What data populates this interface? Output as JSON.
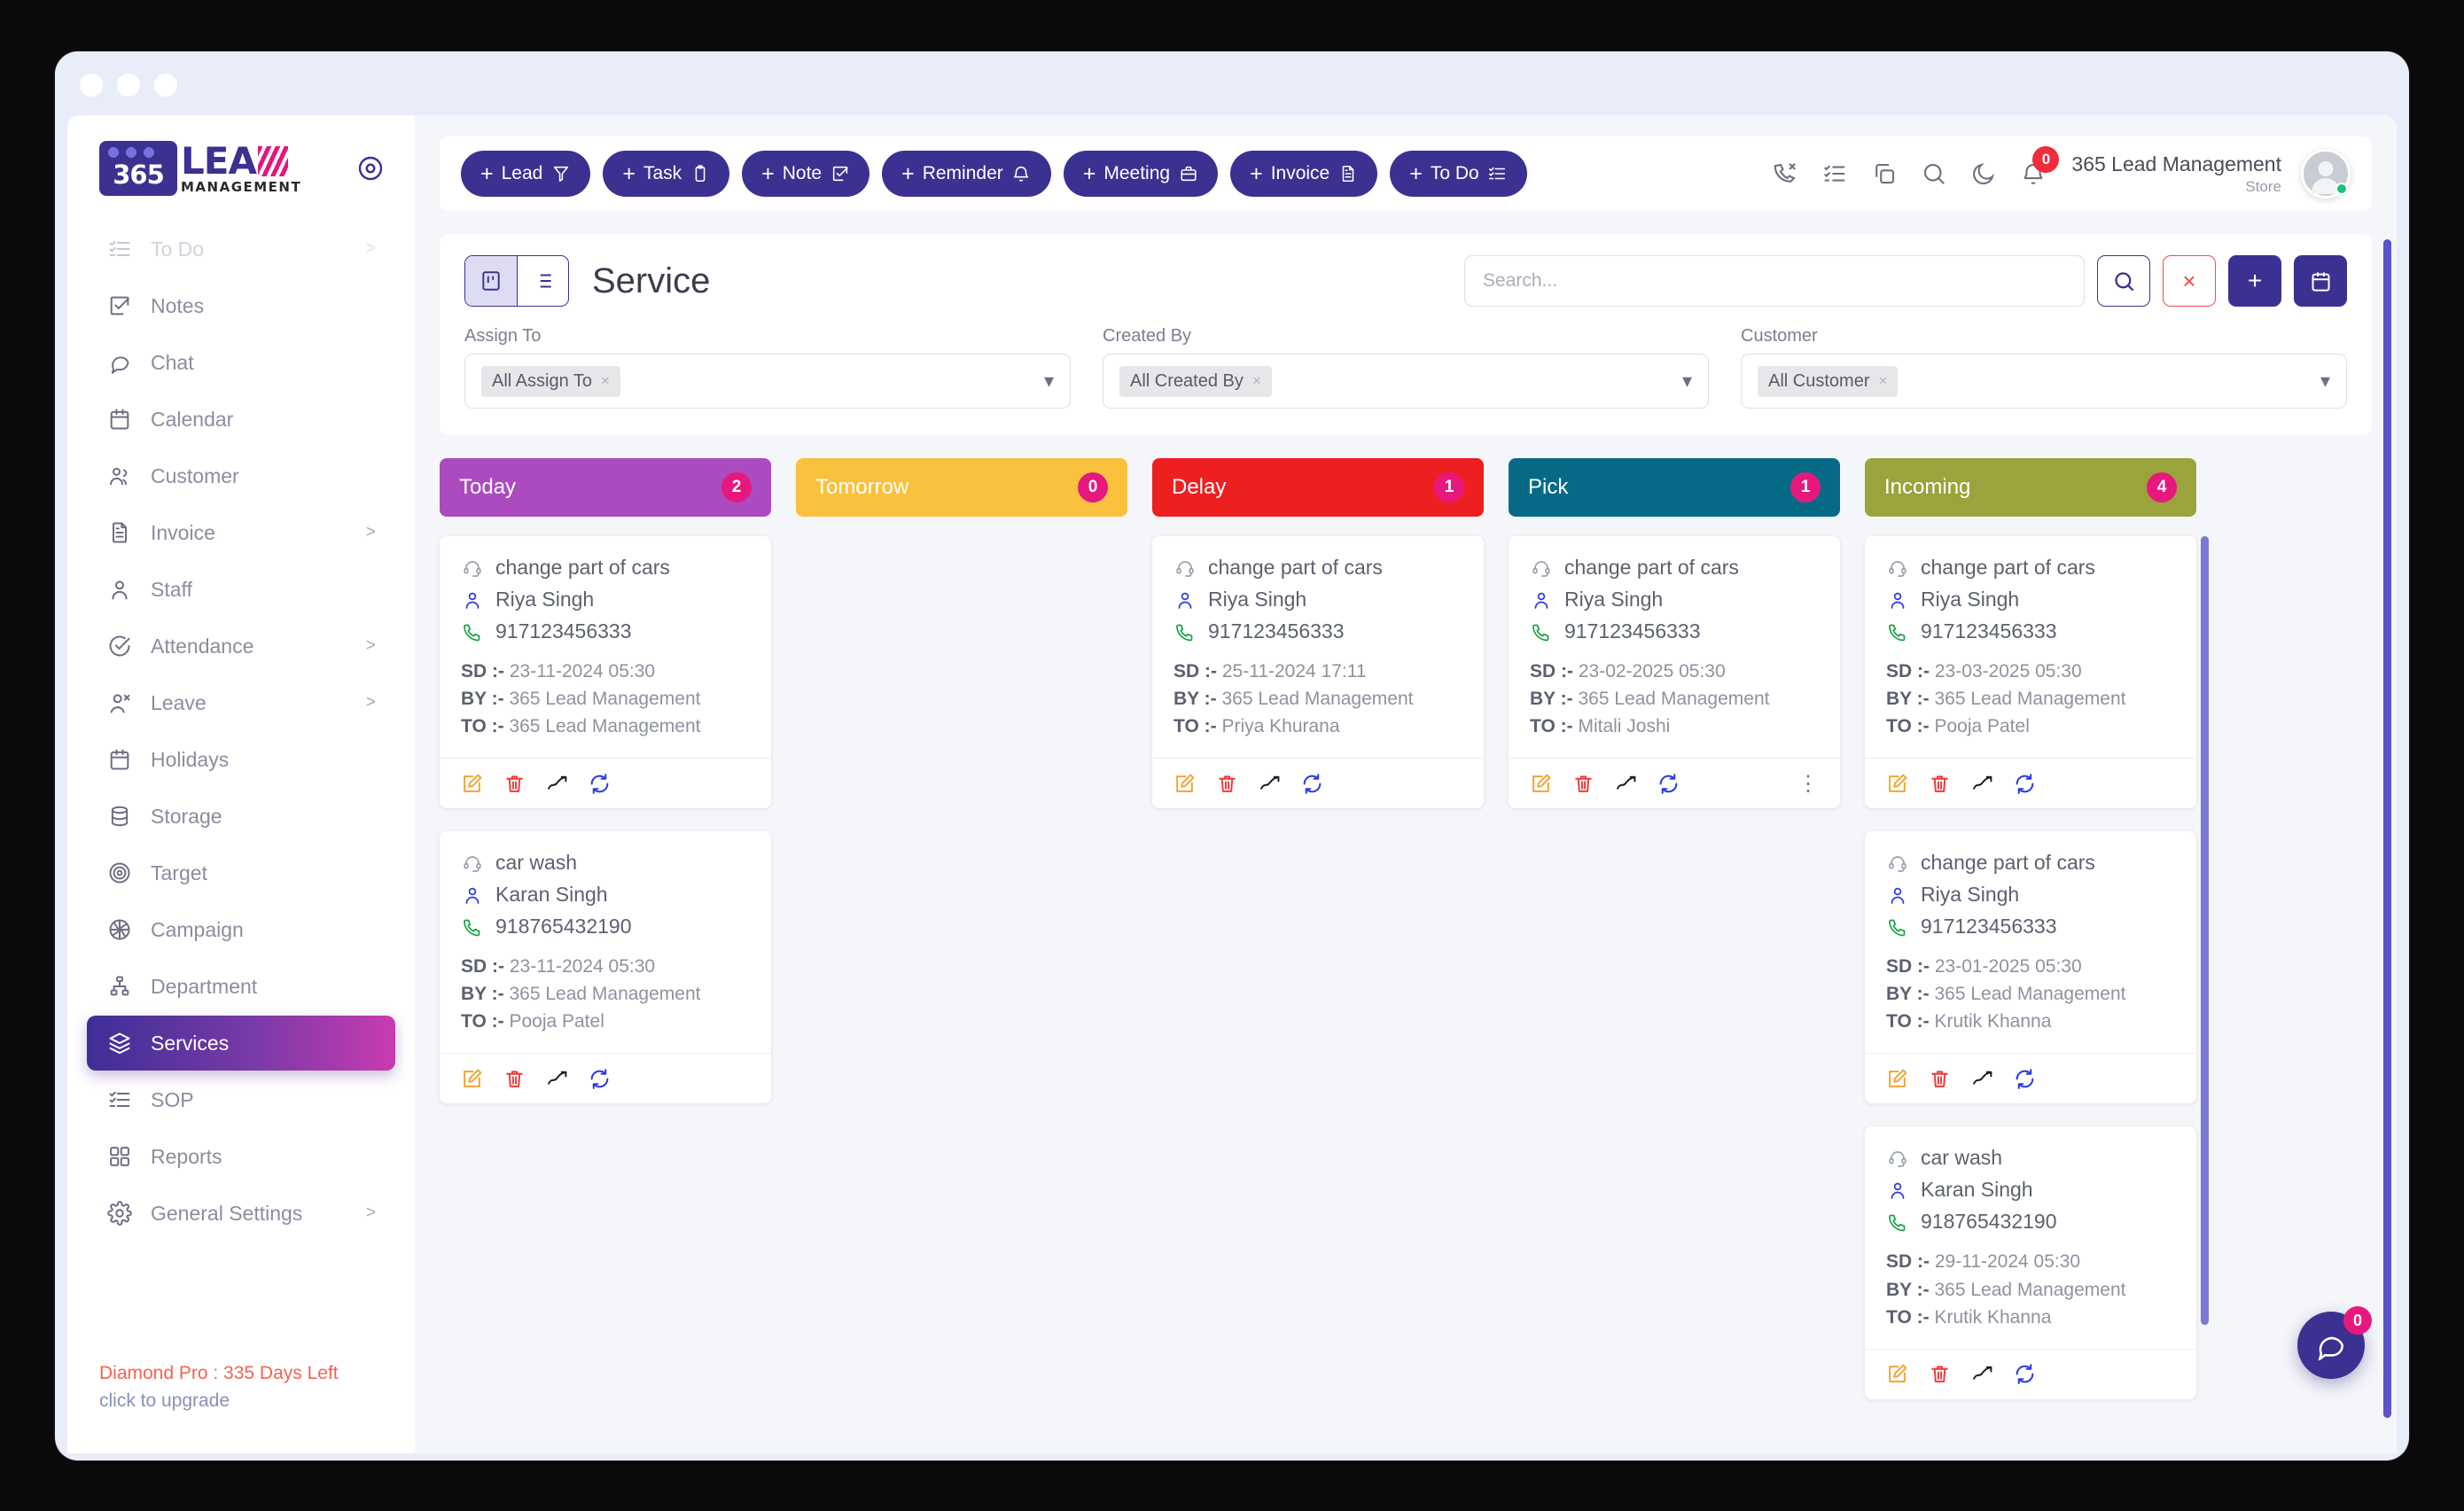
{
  "sidebar": {
    "logo": {
      "badge": "365",
      "lead": "LEA",
      "mgmt": "MANAGEMENT"
    },
    "items": [
      {
        "label": "To Do",
        "icon": "todo-icon",
        "chevron": ">",
        "faded": true,
        "active": false
      },
      {
        "label": "Notes",
        "icon": "note-check-icon",
        "chevron": "",
        "faded": false,
        "active": false
      },
      {
        "label": "Chat",
        "icon": "chat-bubble-icon",
        "chevron": "",
        "faded": false,
        "active": false
      },
      {
        "label": "Calendar",
        "icon": "calendar-icon",
        "chevron": "",
        "faded": false,
        "active": false
      },
      {
        "label": "Customer",
        "icon": "users-icon",
        "chevron": "",
        "faded": false,
        "active": false
      },
      {
        "label": "Invoice",
        "icon": "document-icon",
        "chevron": ">",
        "faded": false,
        "active": false
      },
      {
        "label": "Staff",
        "icon": "user-icon",
        "chevron": "",
        "faded": false,
        "active": false
      },
      {
        "label": "Attendance",
        "icon": "check-circle-icon",
        "chevron": ">",
        "faded": false,
        "active": false
      },
      {
        "label": "Leave",
        "icon": "user-x-icon",
        "chevron": ">",
        "faded": false,
        "active": false
      },
      {
        "label": "Holidays",
        "icon": "calendar-icon",
        "chevron": "",
        "faded": false,
        "active": false
      },
      {
        "label": "Storage",
        "icon": "database-icon",
        "chevron": "",
        "faded": false,
        "active": false
      },
      {
        "label": "Target",
        "icon": "target-icon",
        "chevron": "",
        "faded": false,
        "active": false
      },
      {
        "label": "Campaign",
        "icon": "aperture-icon",
        "chevron": "",
        "faded": false,
        "active": false
      },
      {
        "label": "Department",
        "icon": "hierarchy-icon",
        "chevron": "",
        "faded": false,
        "active": false
      },
      {
        "label": "Services",
        "icon": "layers-icon",
        "chevron": "",
        "faded": false,
        "active": true
      },
      {
        "label": "SOP",
        "icon": "list-check-icon",
        "chevron": "",
        "faded": false,
        "active": false
      },
      {
        "label": "Reports",
        "icon": "grid-icon",
        "chevron": "",
        "faded": false,
        "active": false
      },
      {
        "label": "General Settings",
        "icon": "gear-icon",
        "chevron": ">",
        "faded": false,
        "active": false
      }
    ],
    "upgrade_line1": "Diamond Pro : 335 Days Left",
    "upgrade_line2": "click to upgrade",
    "settings_icon": "settings-target-icon"
  },
  "topbar": {
    "actions": [
      {
        "label": "Lead",
        "icon": "funnel-icon"
      },
      {
        "label": "Task",
        "icon": "clipboard-icon"
      },
      {
        "label": "Note",
        "icon": "note-check-icon"
      },
      {
        "label": "Reminder",
        "icon": "bell-icon"
      },
      {
        "label": "Meeting",
        "icon": "briefcase-icon"
      },
      {
        "label": "Invoice",
        "icon": "document-icon"
      },
      {
        "label": "To Do",
        "icon": "todo-icon"
      }
    ],
    "plus": "+",
    "right_icons": [
      {
        "name": "missed-call-icon"
      },
      {
        "name": "todo-icon"
      },
      {
        "name": "copy-icon"
      },
      {
        "name": "search-icon"
      },
      {
        "name": "moon-icon"
      },
      {
        "name": "bell-icon"
      }
    ],
    "bell_count": "0",
    "account_name": "365 Lead Management",
    "account_sub": "Store"
  },
  "panel": {
    "title": "Service",
    "view_kanban_icon": "kanban-view-icon",
    "view_list_icon": "list-view-icon",
    "search_placeholder": "Search...",
    "search_value": "",
    "buttons": {
      "search": "search-icon",
      "clear": "×",
      "add": "+",
      "calendar": "calendar-icon"
    },
    "filters": [
      {
        "label": "Assign To",
        "chip": "All Assign To",
        "chip_x": "×"
      },
      {
        "label": "Created By",
        "chip": "All Created By",
        "chip_x": "×"
      },
      {
        "label": "Customer",
        "chip": "All Customer",
        "chip_x": "×"
      }
    ]
  },
  "board": {
    "columns": [
      {
        "title": "Today",
        "count": "2",
        "color": "#ac4bc0",
        "cards": [
          {
            "service": "change part of cars",
            "person": "Riya Singh",
            "phone": "917123456333",
            "sd_label": "SD :-",
            "sd": "23-11-2024 05:30",
            "by_label": "BY :-",
            "by": "365 Lead Management",
            "to_label": "TO :-",
            "to": "365 Lead Management",
            "more": false
          },
          {
            "service": "car wash",
            "person": "Karan Singh",
            "phone": "918765432190",
            "sd_label": "SD :-",
            "sd": "23-11-2024 05:30",
            "by_label": "BY :-",
            "by": "365 Lead Management",
            "to_label": "TO :-",
            "to": "Pooja Patel",
            "more": false
          }
        ]
      },
      {
        "title": "Tomorrow",
        "count": "0",
        "color": "#f9c13e",
        "cards": []
      },
      {
        "title": "Delay",
        "count": "1",
        "color": "#ee1f21",
        "cards": [
          {
            "service": "change part of cars",
            "person": "Riya Singh",
            "phone": "917123456333",
            "sd_label": "SD :-",
            "sd": "25-11-2024 17:11",
            "by_label": "BY :-",
            "by": "365 Lead Management",
            "to_label": "TO :-",
            "to": "Priya Khurana",
            "more": false
          }
        ]
      },
      {
        "title": "Pick",
        "count": "1",
        "color": "#066a86",
        "cards": [
          {
            "service": "change part of cars",
            "person": "Riya Singh",
            "phone": "917123456333",
            "sd_label": "SD :-",
            "sd": "23-02-2025 05:30",
            "by_label": "BY :-",
            "by": "365 Lead Management",
            "to_label": "TO :-",
            "to": "Mitali Joshi",
            "more": true
          }
        ]
      },
      {
        "title": "Incoming",
        "count": "4",
        "color": "#9aa33c",
        "cards": [
          {
            "service": "change part of cars",
            "person": "Riya Singh",
            "phone": "917123456333",
            "sd_label": "SD :-",
            "sd": "23-03-2025 05:30",
            "by_label": "BY :-",
            "by": "365 Lead Management",
            "to_label": "TO :-",
            "to": "Pooja Patel",
            "more": false
          },
          {
            "service": "change part of cars",
            "person": "Riya Singh",
            "phone": "917123456333",
            "sd_label": "SD :-",
            "sd": "23-01-2025 05:30",
            "by_label": "BY :-",
            "by": "365 Lead Management",
            "to_label": "TO :-",
            "to": "Krutik Khanna",
            "more": false
          },
          {
            "service": "car wash",
            "person": "Karan Singh",
            "phone": "918765432190",
            "sd_label": "SD :-",
            "sd": "29-11-2024 05:30",
            "by_label": "BY :-",
            "by": "365 Lead Management",
            "to_label": "TO :-",
            "to": "Krutik Khanna",
            "more": false
          }
        ]
      }
    ],
    "card_actions": [
      {
        "name": "edit-icon"
      },
      {
        "name": "delete-icon"
      },
      {
        "name": "trend-icon"
      },
      {
        "name": "sync-icon"
      }
    ],
    "more_glyph": "⋮"
  },
  "chat_widget": {
    "icon": "chat-bubble-icon",
    "count": "0"
  }
}
